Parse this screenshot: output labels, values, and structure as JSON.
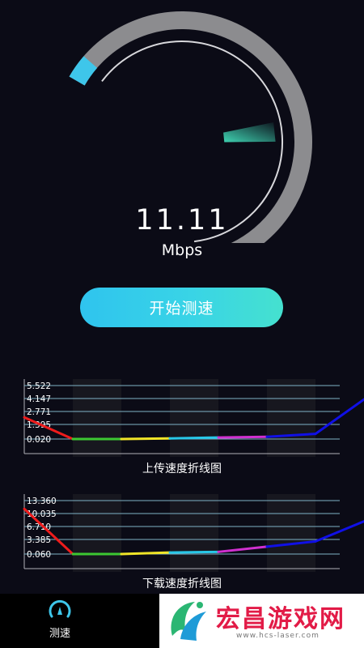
{
  "speed": {
    "value": "11.11",
    "unit": "Mbps",
    "gauge_fraction": 0.6
  },
  "start_button": {
    "label": "开始测速"
  },
  "colors": {
    "gauge_track": "#8c8c8f",
    "gauge_progress": "#3ec6ea",
    "needle": "#3fd3b2",
    "grid_line": "#7fb3c7",
    "band": "#17171f"
  },
  "upload_chart": {
    "caption": "上传速度折线图",
    "chart_data": {
      "type": "line",
      "y_ticks": [
        "5.522",
        "4.147",
        "2.771",
        "1.395",
        "0.020"
      ],
      "ylim": [
        0.02,
        5.522
      ],
      "values": [
        2.25,
        0.02,
        0.02,
        0.08,
        0.18,
        0.25,
        0.55,
        4.1
      ],
      "segment_colors": [
        "#ee1c1c",
        "#3cc832",
        "#f0e528",
        "#28c8e8",
        "#d030d0",
        "#1010e6",
        "#1010e6"
      ]
    }
  },
  "download_chart": {
    "caption": "下载速度折线图",
    "chart_data": {
      "type": "line",
      "y_ticks": [
        "13.360",
        "10.035",
        "6.710",
        "3.385",
        "0.060"
      ],
      "ylim": [
        0.06,
        13.36
      ],
      "values": [
        11.3,
        0.06,
        0.06,
        0.45,
        0.6,
        1.9,
        3.2,
        8.2
      ],
      "segment_colors": [
        "#ee1c1c",
        "#3cc832",
        "#f0e528",
        "#28c8e8",
        "#d030d0",
        "#1010e6",
        "#1010e6"
      ]
    }
  },
  "nav": {
    "tabs": [
      {
        "label": "测速",
        "icon": "speedometer-icon"
      }
    ]
  },
  "watermark": {
    "text": "宏昌游戏网",
    "url": "www.hcs-laser.com",
    "logo": "leaf-logo"
  }
}
